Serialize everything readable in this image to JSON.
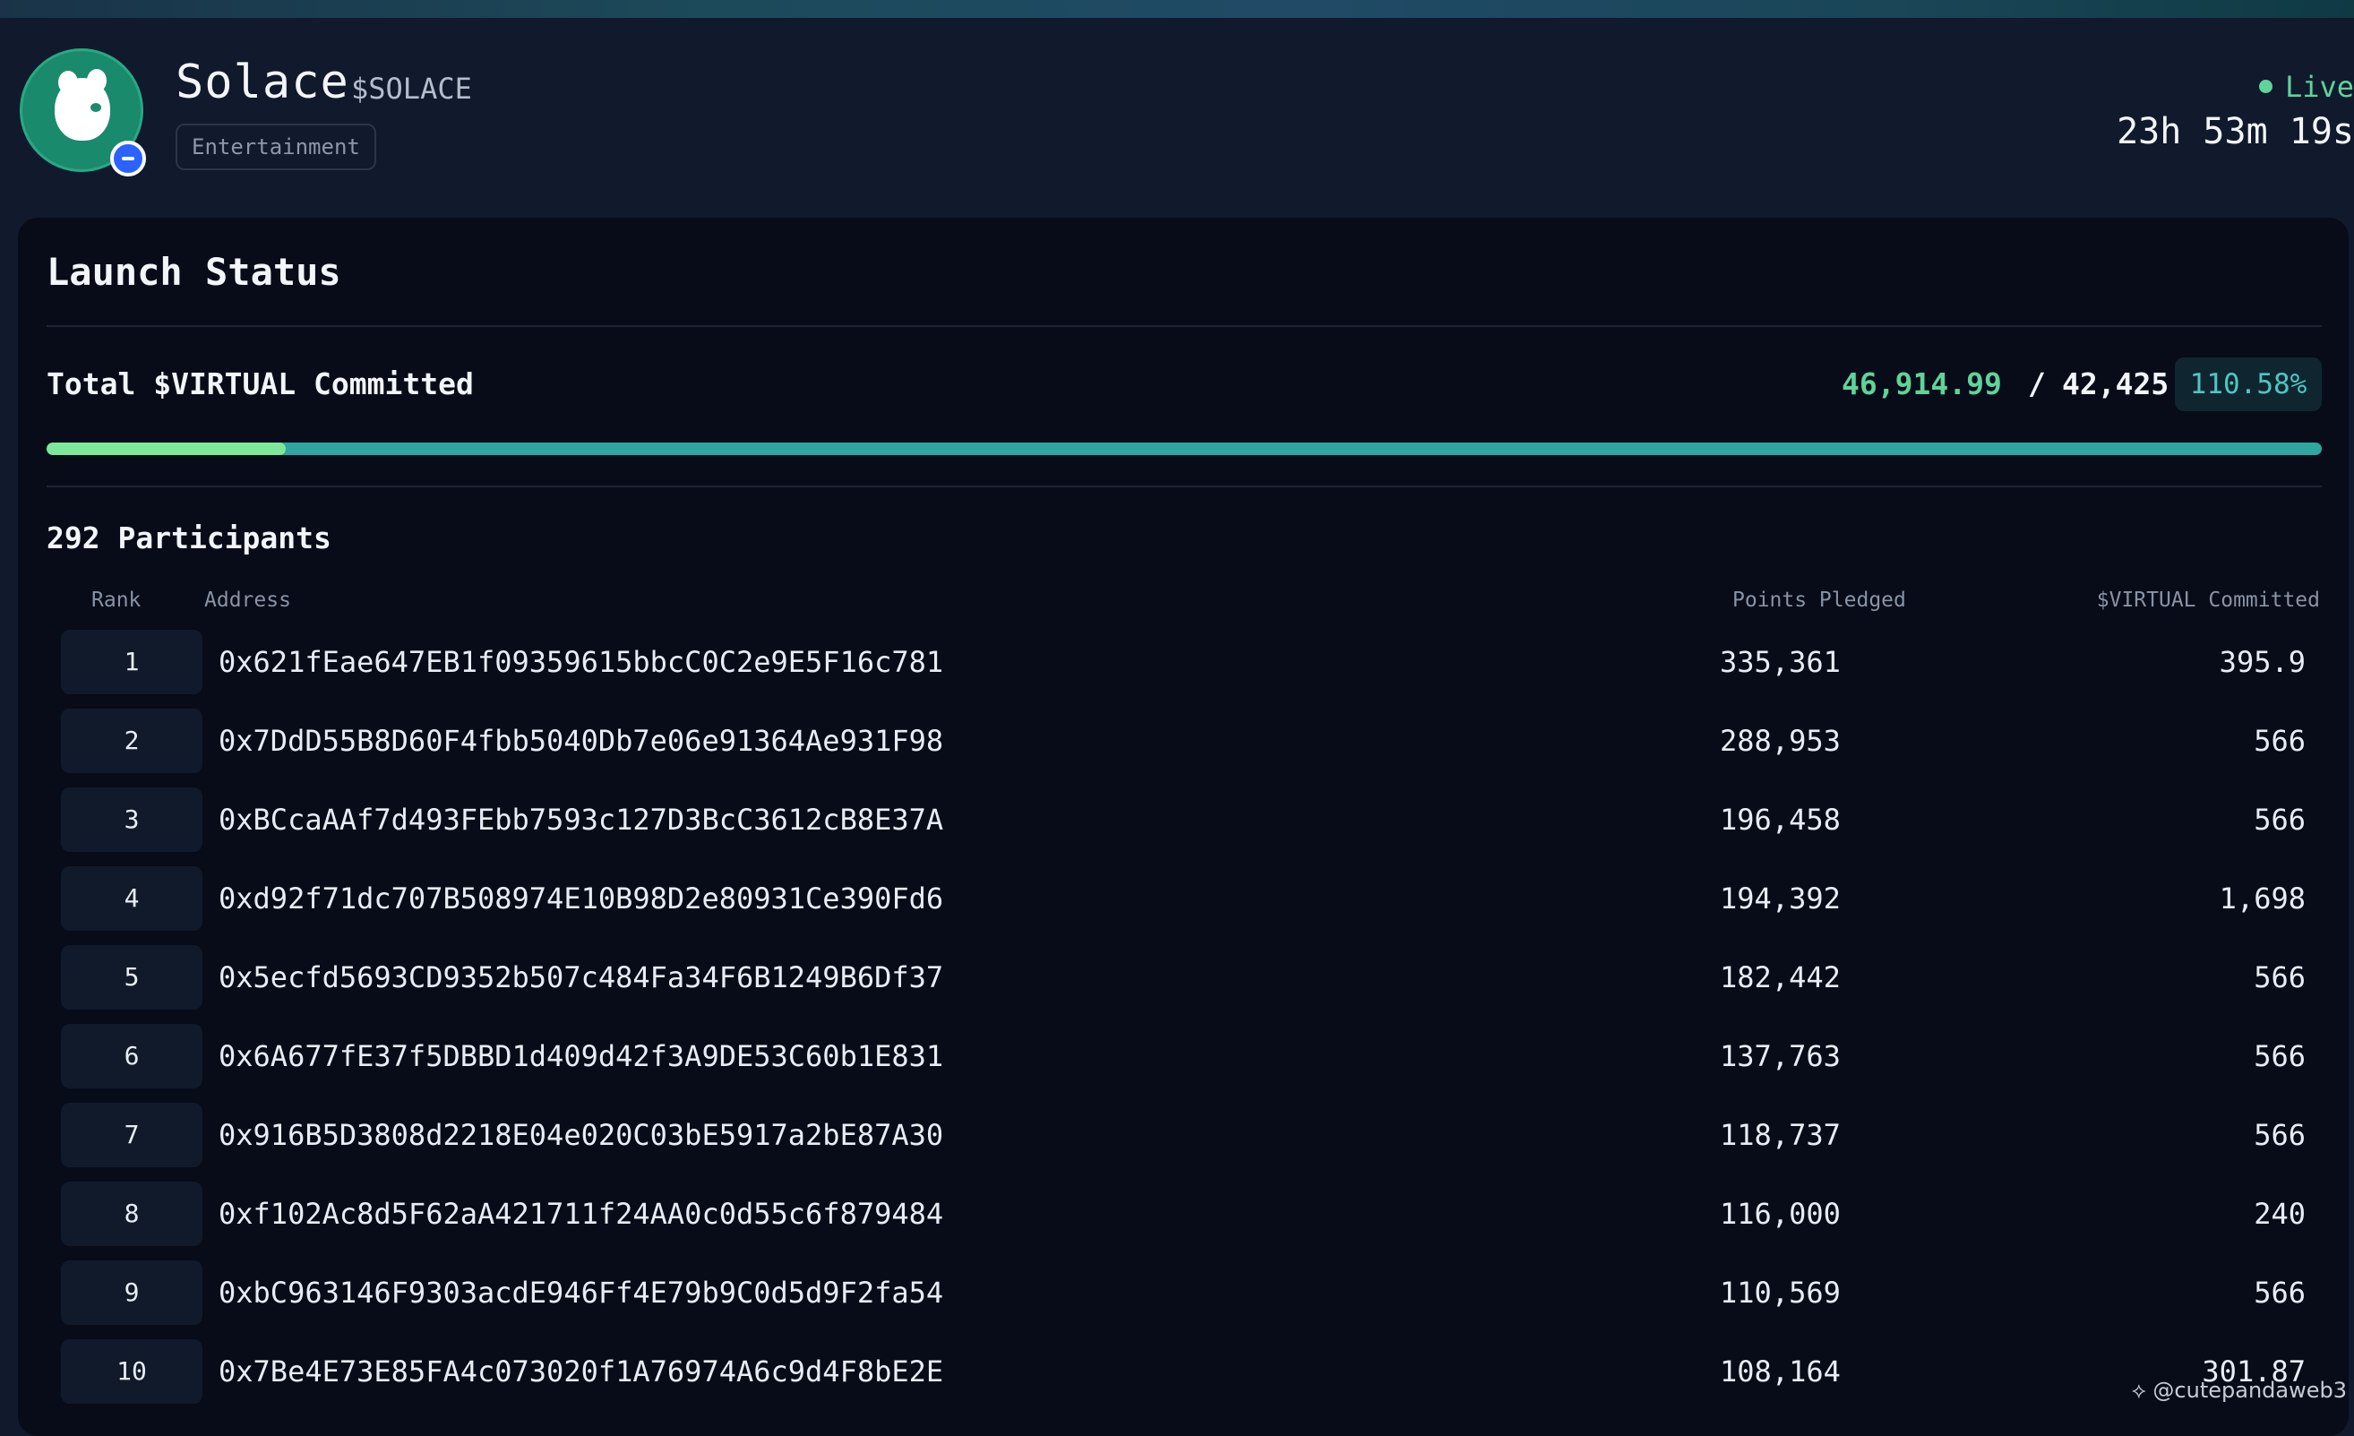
{
  "header": {
    "token_name": "Solace",
    "ticker": "$SOLACE",
    "category": "Entertainment",
    "status": "Live",
    "countdown": "23h 53m 19s"
  },
  "launch": {
    "title": "Launch Status",
    "committed_label": "Total $VIRTUAL Committed",
    "committed_current": "46,914.99",
    "separator": "/",
    "committed_goal": "42,425",
    "percent": "110.58%",
    "progress_highlight_fraction": 0.105
  },
  "participants": {
    "title": "292 Participants",
    "columns": {
      "rank": "Rank",
      "address": "Address",
      "points": "Points Pledged",
      "virtual": "$VIRTUAL Committed"
    },
    "rows": [
      {
        "rank": "1",
        "address": "0x621fEae647EB1f09359615bbcC0C2e9E5F16c781",
        "points": "335,361",
        "virtual": "395.9"
      },
      {
        "rank": "2",
        "address": "0x7DdD55B8D60F4fbb5040Db7e06e91364Ae931F98",
        "points": "288,953",
        "virtual": "566"
      },
      {
        "rank": "3",
        "address": "0xBCcaAAf7d493FEbb7593c127D3BcC3612cB8E37A",
        "points": "196,458",
        "virtual": "566"
      },
      {
        "rank": "4",
        "address": "0xd92f71dc707B508974E10B98D2e80931Ce390Fd6",
        "points": "194,392",
        "virtual": "1,698"
      },
      {
        "rank": "5",
        "address": "0x5ecfd5693CD9352b507c484Fa34F6B1249B6Df37",
        "points": "182,442",
        "virtual": "566"
      },
      {
        "rank": "6",
        "address": "0x6A677fE37f5DBBD1d409d42f3A9DE53C60b1E831",
        "points": "137,763",
        "virtual": "566"
      },
      {
        "rank": "7",
        "address": "0x916B5D3808d2218E04e020C03bE5917a2bE87A30",
        "points": "118,737",
        "virtual": "566"
      },
      {
        "rank": "8",
        "address": "0xf102Ac8d5F62aA421711f24AA0c0d55c6f879484",
        "points": "116,000",
        "virtual": "240"
      },
      {
        "rank": "9",
        "address": "0xbC963146F9303acdE946Ff4E79b9C0d5d9F2fa54",
        "points": "110,569",
        "virtual": "566"
      },
      {
        "rank": "10",
        "address": "0x7Be4E73E85FA4c073020f1A76974A6c9d4F8bE2E",
        "points": "108,164",
        "virtual": "301.87"
      }
    ]
  },
  "watermark": "@cutepandaweb3",
  "colors": {
    "accent_green": "#5fd39a",
    "progress_teal": "#2fa7a0",
    "progress_highlight": "#7de89a",
    "percent_text": "#4fc6c3"
  }
}
